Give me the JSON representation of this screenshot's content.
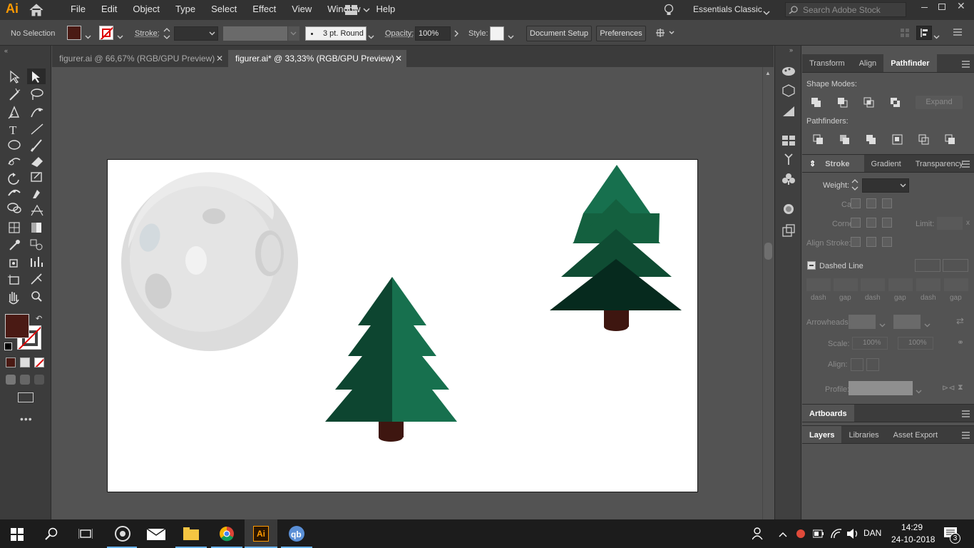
{
  "app": {
    "logo": "Ai"
  },
  "menu": [
    "File",
    "Edit",
    "Object",
    "Type",
    "Select",
    "Effect",
    "View",
    "Window",
    "Help"
  ],
  "workspace": "Essentials Classic",
  "search_placeholder": "Search Adobe Stock",
  "control": {
    "selection": "No Selection",
    "stroke_label": "Stroke:",
    "brush": "3 pt. Round",
    "opacity_label": "Opacity:",
    "opacity": "100%",
    "style_label": "Style:",
    "doc_setup": "Document Setup",
    "preferences": "Preferences"
  },
  "tabs": [
    {
      "label": "figurer.ai @ 66,67% (RGB/GPU Preview)"
    },
    {
      "label": "figurer.ai* @ 33,33% (RGB/GPU Preview)"
    }
  ],
  "panel": {
    "top_tabs": [
      "Transform",
      "Align",
      "Pathfinder"
    ],
    "shape_modes": "Shape Modes:",
    "expand": "Expand",
    "pathfinders": "Pathfinders:",
    "stroke_tabs": [
      "Stroke",
      "Gradient",
      "Transparency"
    ],
    "weight": "Weight:",
    "cap": "Cap:",
    "corner": "Corner:",
    "limit": "Limit:",
    "align_stroke": "Align Stroke:",
    "dashed_line": "Dashed Line",
    "dash_labels": [
      "dash",
      "gap",
      "dash",
      "gap",
      "dash",
      "gap"
    ],
    "arrowheads": "Arrowheads:",
    "scale": "Scale:",
    "scale_val1": "100%",
    "scale_val2": "100%",
    "align": "Align:",
    "profile": "Profile:",
    "artboards": "Artboards",
    "bottom_tabs": [
      "Layers",
      "Libraries",
      "Asset Export"
    ]
  },
  "tray": {
    "lang": "DAN",
    "time": "14:29",
    "date": "24-10-2018",
    "notifications": "3"
  },
  "colors": {
    "fill": "#4a1a14",
    "tree_dark": "#0a3d2a",
    "tree_light": "#17704e",
    "trunk": "#3e1610",
    "moon": "#e0e0e0"
  }
}
